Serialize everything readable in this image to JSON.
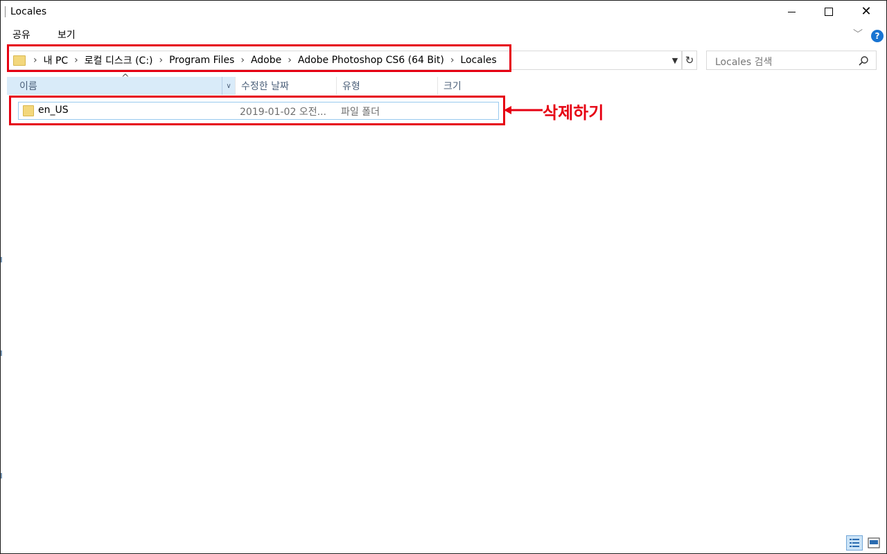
{
  "window": {
    "title": "Locales"
  },
  "ribbon": {
    "tabs": [
      "공유",
      "보기"
    ]
  },
  "address": {
    "crumbs": [
      "내 PC",
      "로컬 디스크 (C:)",
      "Program Files",
      "Adobe",
      "Adobe Photoshop CS6 (64 Bit)",
      "Locales"
    ]
  },
  "search": {
    "placeholder": "Locales 검색"
  },
  "columns": {
    "name": "이름",
    "date": "수정한 날짜",
    "type": "유형",
    "size": "크기"
  },
  "files": [
    {
      "name": "en_US",
      "date": "2019-01-02 오전...",
      "type": "파일 폴더",
      "size": ""
    }
  ],
  "annotation": {
    "text": "삭제하기",
    "color": "#e60012"
  },
  "colors": {
    "highlight": "#e60012",
    "selection": "#d9ebf9",
    "accent": "#1874d2"
  }
}
